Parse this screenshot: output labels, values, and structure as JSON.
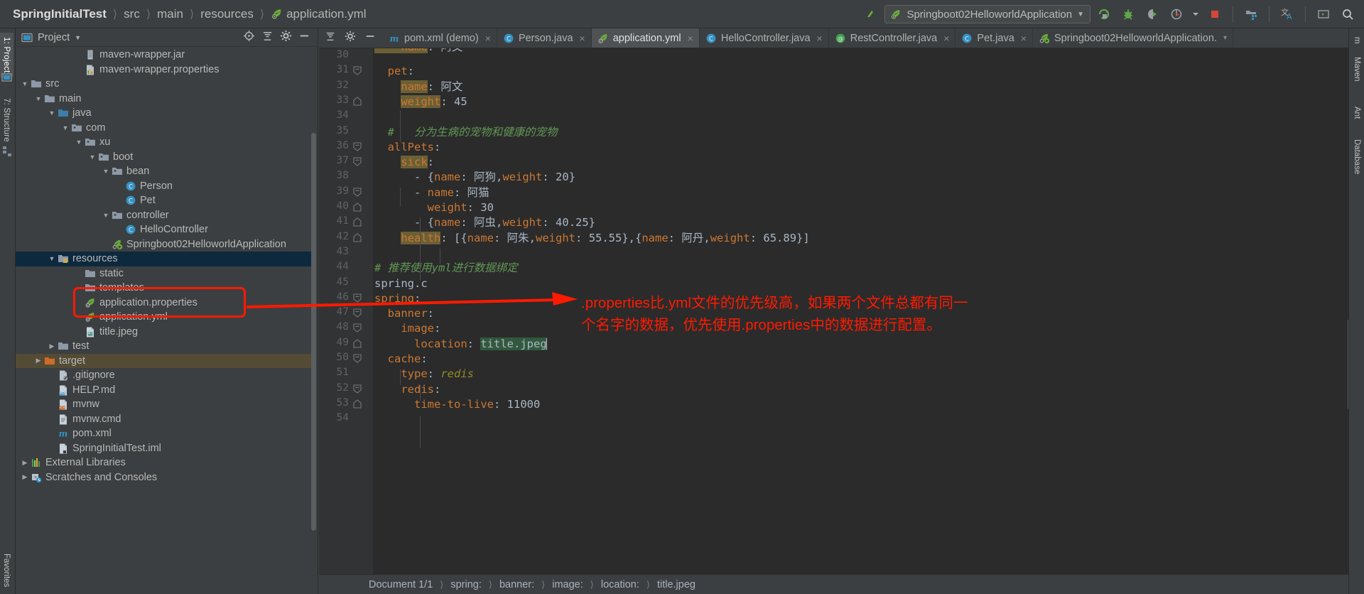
{
  "navbar": {
    "breadcrumbs": [
      {
        "label": "SpringInitialTest",
        "icon": "none"
      },
      {
        "label": "src",
        "icon": "none"
      },
      {
        "label": "main",
        "icon": "none"
      },
      {
        "label": "resources",
        "icon": "none"
      },
      {
        "label": "application.yml",
        "icon": "spring-leaf-icon"
      }
    ],
    "back_icon": "back-arrow-icon",
    "run_config": {
      "label": "Springboot02HelloworldApplication",
      "icon": "spring-leaf-icon",
      "chevron": "▼"
    },
    "buttons": [
      {
        "name": "run-button",
        "icon": "run-icon"
      },
      {
        "name": "debug-button",
        "icon": "bug-icon"
      },
      {
        "name": "run-with-coverage-button",
        "icon": "coverage-icon"
      },
      {
        "name": "profiler-button",
        "icon": "profiler-icon"
      },
      {
        "name": "stop-button",
        "icon": "stop-square-icon"
      },
      {
        "name": "project-structure-button",
        "icon": "project-structure-icon"
      },
      {
        "name": "translate-button",
        "icon": "translate-icon"
      },
      {
        "name": "terminal-button",
        "icon": "terminal-icon"
      },
      {
        "name": "search-everywhere-button",
        "icon": "search-icon"
      }
    ]
  },
  "left_tool_tabs": [
    {
      "label": "1: Project",
      "selected": true
    },
    {
      "label": "7: Structure",
      "selected": false
    },
    {
      "label": "Favorites",
      "selected": false
    }
  ],
  "right_tool_tabs": [
    {
      "label": "m"
    },
    {
      "label": "Maven"
    },
    {
      "label": "Ant"
    },
    {
      "label": "Database"
    }
  ],
  "sidebar": {
    "title": "Project",
    "title_icon": "project-window-icon",
    "title_chevron": "▼",
    "header_icons": [
      {
        "name": "locate-file-icon"
      },
      {
        "name": "collapse-all-icon"
      },
      {
        "name": "settings-gear-icon"
      },
      {
        "name": "hide-icon"
      }
    ],
    "tree": [
      {
        "label": "maven-wrapper.jar",
        "depth": 5,
        "arrow": "none",
        "icon": "jar-file-icon",
        "state": "normal"
      },
      {
        "label": "maven-wrapper.properties",
        "depth": 5,
        "arrow": "none",
        "icon": "properties-file-icon",
        "state": "normal"
      },
      {
        "label": "src",
        "depth": 1,
        "arrow": "expanded",
        "icon": "folder-icon",
        "state": "normal"
      },
      {
        "label": "main",
        "depth": 2,
        "arrow": "expanded",
        "icon": "folder-icon",
        "state": "normal"
      },
      {
        "label": "java",
        "depth": 3,
        "arrow": "expanded",
        "icon": "source-folder-icon",
        "state": "normal"
      },
      {
        "label": "com",
        "depth": 4,
        "arrow": "expanded",
        "icon": "package-icon",
        "state": "normal"
      },
      {
        "label": "xu",
        "depth": 5,
        "arrow": "expanded",
        "icon": "package-icon",
        "state": "normal"
      },
      {
        "label": "boot",
        "depth": 6,
        "arrow": "expanded",
        "icon": "package-icon",
        "state": "normal"
      },
      {
        "label": "bean",
        "depth": 7,
        "arrow": "expanded",
        "icon": "package-icon",
        "state": "normal"
      },
      {
        "label": "Person",
        "depth": 8,
        "arrow": "none",
        "icon": "java-class-icon",
        "state": "normal"
      },
      {
        "label": "Pet",
        "depth": 8,
        "arrow": "none",
        "icon": "java-class-icon",
        "state": "normal"
      },
      {
        "label": "controller",
        "depth": 7,
        "arrow": "expanded",
        "icon": "package-icon",
        "state": "normal"
      },
      {
        "label": "HelloController",
        "depth": 8,
        "arrow": "none",
        "icon": "java-class-icon",
        "state": "normal"
      },
      {
        "label": "Springboot02HelloworldApplication",
        "depth": 7,
        "arrow": "none",
        "icon": "spring-boot-app-icon",
        "state": "normal"
      },
      {
        "label": "resources",
        "depth": 3,
        "arrow": "expanded",
        "icon": "resources-folder-icon",
        "state": "selected"
      },
      {
        "label": "static",
        "depth": 5,
        "arrow": "none",
        "icon": "folder-icon",
        "state": "normal"
      },
      {
        "label": "templates",
        "depth": 5,
        "arrow": "none",
        "icon": "folder-icon",
        "state": "normal"
      },
      {
        "label": "application.properties",
        "depth": 5,
        "arrow": "none",
        "icon": "spring-leaf-icon",
        "state": "normal"
      },
      {
        "label": "application.yml",
        "depth": 5,
        "arrow": "none",
        "icon": "spring-leaf-icon",
        "state": "normal"
      },
      {
        "label": "title.jpeg",
        "depth": 5,
        "arrow": "none",
        "icon": "image-file-icon",
        "state": "normal"
      },
      {
        "label": "test",
        "depth": 3,
        "arrow": "collapsed",
        "icon": "folder-icon",
        "state": "normal"
      },
      {
        "label": "target",
        "depth": 2,
        "arrow": "collapsed",
        "icon": "target-folder-icon",
        "state": "excluded"
      },
      {
        "label": ".gitignore",
        "depth": 3,
        "arrow": "none",
        "icon": "gitignore-file-icon",
        "state": "normal"
      },
      {
        "label": "HELP.md",
        "depth": 3,
        "arrow": "none",
        "icon": "markdown-file-icon",
        "state": "normal"
      },
      {
        "label": "mvnw",
        "depth": 3,
        "arrow": "none",
        "icon": "shell-file-icon",
        "state": "normal"
      },
      {
        "label": "mvnw.cmd",
        "depth": 3,
        "arrow": "none",
        "icon": "text-file-icon",
        "state": "normal"
      },
      {
        "label": "pom.xml",
        "depth": 3,
        "arrow": "none",
        "icon": "maven-pom-icon",
        "state": "normal"
      },
      {
        "label": "SpringInitialTest.iml",
        "depth": 3,
        "arrow": "none",
        "icon": "iml-file-icon",
        "state": "normal"
      },
      {
        "label": "External Libraries",
        "depth": 1,
        "arrow": "collapsed",
        "icon": "libraries-icon",
        "state": "normal"
      },
      {
        "label": "Scratches and Consoles",
        "depth": 1,
        "arrow": "collapsed",
        "icon": "scratches-icon",
        "state": "normal"
      }
    ]
  },
  "editor": {
    "tab_tools": [
      {
        "name": "collapse-all-icon"
      },
      {
        "name": "settings-gear-icon"
      },
      {
        "name": "hide-panel-icon"
      }
    ],
    "tabs": [
      {
        "label": "pom.xml (demo)",
        "icon": "maven-pom-icon",
        "active": false,
        "closable": true
      },
      {
        "label": "Person.java",
        "icon": "java-class-icon",
        "active": false,
        "closable": true
      },
      {
        "label": "application.yml",
        "icon": "spring-leaf-icon",
        "active": true,
        "closable": true
      },
      {
        "label": "HelloController.java",
        "icon": "java-class-icon",
        "active": false,
        "closable": true
      },
      {
        "label": "RestController.java",
        "icon": "java-annotation-icon",
        "active": false,
        "closable": true
      },
      {
        "label": "Pet.java",
        "icon": "java-class-icon",
        "active": false,
        "closable": true
      },
      {
        "label": "Springboot02HelloworldApplication.",
        "icon": "spring-boot-app-icon",
        "active": false,
        "closable": false
      }
    ],
    "first_line_number": 30,
    "lines": [
      {
        "n": 30,
        "fold": "none",
        "tokens": []
      },
      {
        "n": 31,
        "fold": "start",
        "tokens": [
          {
            "t": "  ",
            "c": "k-val"
          },
          {
            "t": "pet",
            "c": "k-key"
          },
          {
            "t": ":",
            "c": "k-val"
          }
        ]
      },
      {
        "n": 32,
        "fold": "none",
        "tokens": [
          {
            "t": "    ",
            "c": "k-val"
          },
          {
            "t": "name",
            "c": "k-hl"
          },
          {
            "t": ": ",
            "c": "k-val"
          },
          {
            "t": "阿文",
            "c": "k-val"
          }
        ]
      },
      {
        "n": 33,
        "fold": "end",
        "tokens": [
          {
            "t": "    ",
            "c": "k-val"
          },
          {
            "t": "weight",
            "c": "k-hl"
          },
          {
            "t": ": ",
            "c": "k-val"
          },
          {
            "t": "45",
            "c": "k-num"
          }
        ]
      },
      {
        "n": 34,
        "fold": "none",
        "tokens": []
      },
      {
        "n": 35,
        "fold": "none",
        "tokens": [
          {
            "t": "  #   分为生病的宠物和健康的宠物",
            "c": "k-cmt"
          }
        ]
      },
      {
        "n": 36,
        "fold": "start",
        "tokens": [
          {
            "t": "  ",
            "c": "k-val"
          },
          {
            "t": "allPets",
            "c": "k-key"
          },
          {
            "t": ":",
            "c": "k-val"
          }
        ]
      },
      {
        "n": 37,
        "fold": "start",
        "tokens": [
          {
            "t": "    ",
            "c": "k-val"
          },
          {
            "t": "sick",
            "c": "k-hl"
          },
          {
            "t": ":",
            "c": "k-val"
          }
        ]
      },
      {
        "n": 38,
        "fold": "none",
        "tokens": [
          {
            "t": "      - {",
            "c": "k-val"
          },
          {
            "t": "name",
            "c": "k-key"
          },
          {
            "t": ": ",
            "c": "k-val"
          },
          {
            "t": "阿狗",
            "c": "k-val"
          },
          {
            "t": ",",
            "c": "k-val"
          },
          {
            "t": "weight",
            "c": "k-key"
          },
          {
            "t": ": ",
            "c": "k-val"
          },
          {
            "t": "20}",
            "c": "k-num"
          }
        ]
      },
      {
        "n": 39,
        "fold": "start",
        "tokens": [
          {
            "t": "      - ",
            "c": "k-val"
          },
          {
            "t": "name",
            "c": "k-key"
          },
          {
            "t": ": ",
            "c": "k-val"
          },
          {
            "t": "阿猫",
            "c": "k-val"
          }
        ]
      },
      {
        "n": 40,
        "fold": "end",
        "tokens": [
          {
            "t": "        ",
            "c": "k-val"
          },
          {
            "t": "weight",
            "c": "k-key"
          },
          {
            "t": ": ",
            "c": "k-val"
          },
          {
            "t": "30",
            "c": "k-num"
          }
        ]
      },
      {
        "n": 41,
        "fold": "end",
        "tokens": [
          {
            "t": "      - {",
            "c": "k-val"
          },
          {
            "t": "name",
            "c": "k-key"
          },
          {
            "t": ": ",
            "c": "k-val"
          },
          {
            "t": "阿虫",
            "c": "k-val"
          },
          {
            "t": ",",
            "c": "k-val"
          },
          {
            "t": "weight",
            "c": "k-key"
          },
          {
            "t": ": ",
            "c": "k-val"
          },
          {
            "t": "40.25}",
            "c": "k-num"
          }
        ]
      },
      {
        "n": 42,
        "fold": "end",
        "tokens": [
          {
            "t": "    ",
            "c": "k-val"
          },
          {
            "t": "health",
            "c": "k-hl"
          },
          {
            "t": ": [{",
            "c": "k-val"
          },
          {
            "t": "name",
            "c": "k-key"
          },
          {
            "t": ": ",
            "c": "k-val"
          },
          {
            "t": "阿朱",
            "c": "k-val"
          },
          {
            "t": ",",
            "c": "k-val"
          },
          {
            "t": "weight",
            "c": "k-key"
          },
          {
            "t": ": ",
            "c": "k-val"
          },
          {
            "t": "55.55},{",
            "c": "k-num"
          },
          {
            "t": "name",
            "c": "k-key"
          },
          {
            "t": ": ",
            "c": "k-val"
          },
          {
            "t": "阿丹",
            "c": "k-val"
          },
          {
            "t": ",",
            "c": "k-val"
          },
          {
            "t": "weight",
            "c": "k-key"
          },
          {
            "t": ": ",
            "c": "k-val"
          },
          {
            "t": "65.89}]",
            "c": "k-num"
          }
        ]
      },
      {
        "n": 43,
        "fold": "none",
        "tokens": []
      },
      {
        "n": 44,
        "fold": "none",
        "tokens": [
          {
            "t": "# 推荐使用yml进行数据绑定",
            "c": "k-cmt"
          }
        ]
      },
      {
        "n": 45,
        "fold": "none",
        "tokens": [
          {
            "t": "spring.c",
            "c": "k-val"
          }
        ]
      },
      {
        "n": 46,
        "fold": "start",
        "tokens": [
          {
            "t": "spring",
            "c": "k-key"
          },
          {
            "t": ":",
            "c": "k-val"
          }
        ]
      },
      {
        "n": 47,
        "fold": "start",
        "tokens": [
          {
            "t": "  ",
            "c": "k-val"
          },
          {
            "t": "banner",
            "c": "k-key"
          },
          {
            "t": ":",
            "c": "k-val"
          }
        ]
      },
      {
        "n": 48,
        "fold": "start",
        "tokens": [
          {
            "t": "    ",
            "c": "k-val"
          },
          {
            "t": "image",
            "c": "k-key"
          },
          {
            "t": ":",
            "c": "k-val"
          }
        ]
      },
      {
        "n": 49,
        "fold": "end",
        "tokens": [
          {
            "t": "      ",
            "c": "k-val"
          },
          {
            "t": "location",
            "c": "k-key"
          },
          {
            "t": ": ",
            "c": "k-val"
          },
          {
            "t": "title.jpeg",
            "c": "k-sel"
          },
          {
            "t": "",
            "c": "caret"
          }
        ]
      },
      {
        "n": 50,
        "fold": "start",
        "tokens": [
          {
            "t": "  ",
            "c": "k-val"
          },
          {
            "t": "cache",
            "c": "k-key"
          },
          {
            "t": ":",
            "c": "k-val"
          }
        ]
      },
      {
        "n": 51,
        "fold": "none",
        "tokens": [
          {
            "t": "    ",
            "c": "k-val"
          },
          {
            "t": "type",
            "c": "k-key"
          },
          {
            "t": ": ",
            "c": "k-val"
          },
          {
            "t": "redis",
            "c": "k-italic"
          }
        ]
      },
      {
        "n": 52,
        "fold": "start",
        "tokens": [
          {
            "t": "    ",
            "c": "k-val"
          },
          {
            "t": "redis",
            "c": "k-key"
          },
          {
            "t": ":",
            "c": "k-val"
          }
        ]
      },
      {
        "n": 53,
        "fold": "end",
        "tokens": [
          {
            "t": "      ",
            "c": "k-val"
          },
          {
            "t": "time-to-live",
            "c": "k-key"
          },
          {
            "t": ": ",
            "c": "k-val"
          },
          {
            "t": "11000",
            "c": "k-num"
          }
        ]
      },
      {
        "n": 54,
        "fold": "none",
        "tokens": []
      }
    ]
  },
  "status_breadcrumb": [
    {
      "label": "Document 1/1"
    },
    {
      "label": "spring:"
    },
    {
      "label": "banner:"
    },
    {
      "label": "image:"
    },
    {
      "label": "location:"
    },
    {
      "label": "title.jpeg"
    }
  ],
  "annotation": {
    "color": "#ff1a00",
    "highlight_target": "application.properties / application.yml",
    "lines": [
      ".properties比.yml文件的优先级高，如果两个文件总都有同一",
      "个名字的数据，优先使用.properties中的数据进行配置。"
    ]
  }
}
